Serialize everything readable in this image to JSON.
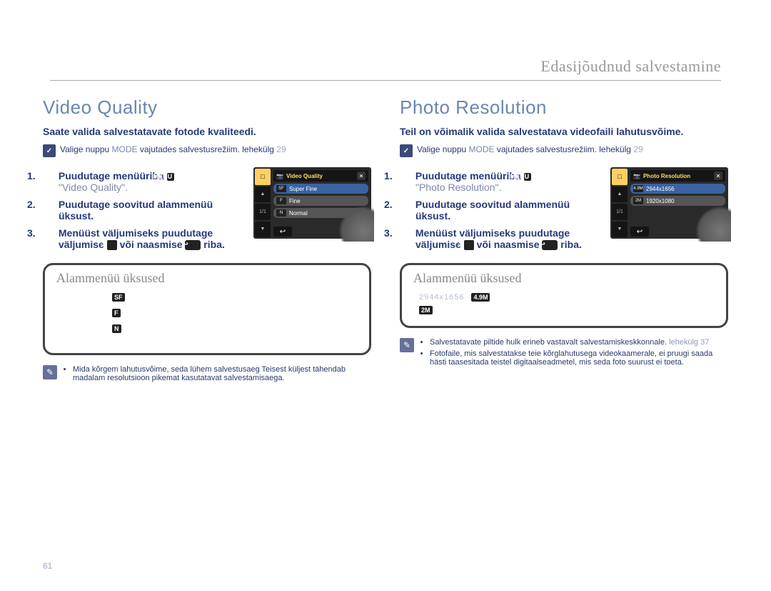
{
  "header": {
    "breadcrumb": "Edasijõudnud salvestamine",
    "page_number": "61"
  },
  "left": {
    "title": "Video Quality",
    "intro": "Saate valida salvestatavate fotode kvaliteedi.",
    "precheck": {
      "icon": "✓",
      "text_a": "Valige nuppu ",
      "mode": "MODE",
      "text_b": " vajutades salvestusrežiim. lehekülg ",
      "page": "29"
    },
    "steps": {
      "s1_a": "Puudutage menüüriba ",
      "s1_menu": "MENU",
      "s1_b": "  ",
      "s1_quote": "\"Video Quality\".",
      "s2": "Puudutage soovitud alammenüü üksust.",
      "s3_a": "Menüüst väljumiseks puudutage väljumise ",
      "s3_x": "✕",
      "s3_b": "  või naasmise ",
      "s3_back": "↩",
      "s3_c": "  riba."
    },
    "lcd": {
      "title": "Video Quality",
      "rail_active": "⬚",
      "rail_page": "1/1",
      "options": [
        {
          "icon": "SF",
          "label": "Super Fine",
          "selected": true
        },
        {
          "icon": "F",
          "label": "Fine",
          "selected": false
        },
        {
          "icon": "N",
          "label": "Normal",
          "selected": false
        }
      ],
      "close": "✕",
      "back": "↩"
    },
    "subpanel": {
      "title": "Alammenüü üksused",
      "rows": [
        {
          "chip": "SF",
          "label": ""
        },
        {
          "chip": "F",
          "label": ""
        },
        {
          "chip": "N",
          "label": ""
        }
      ]
    },
    "note": {
      "icon": "✎",
      "bullets": [
        "Mida kõrgem lahutusvõime, seda lühem salvestusaeg  Teisest küljest tähendab madalam resolutsioon pikemat kasutatavat salvestamisaega."
      ]
    }
  },
  "right": {
    "title": "Photo Resolution",
    "intro": "Teil on võimalik valida salvestatava videofaili lahutusvõime.",
    "precheck": {
      "icon": "✓",
      "text_a": "Valige nuppu ",
      "mode": "MODE",
      "text_b": " vajutades salvestusrežiim.  lehekülg ",
      "page": "29"
    },
    "steps": {
      "s1_a": "Puudutage menüüriba ",
      "s1_menu": "MENU",
      "s1_b": "  ",
      "s1_quote": "\"Photo Resolution\".",
      "s2": "Puudutage soovitud alammenüü üksust.",
      "s3_a": "Menüüst väljumiseks puudutage väljumise ",
      "s3_x": "✕",
      "s3_b": "  või naasmise ",
      "s3_back": "↩",
      "s3_c": "  riba."
    },
    "lcd": {
      "title": "Photo Resolution",
      "rail_active": "⬚",
      "rail_page": "1/1",
      "options": [
        {
          "icon": "4.9M",
          "label": "2944x1656",
          "selected": true
        },
        {
          "icon": "2M",
          "label": "1920x1080",
          "selected": false
        }
      ],
      "close": "✕",
      "back": "↩"
    },
    "subpanel": {
      "title": "Alammenüü üksused",
      "rows": [
        {
          "dotted": "2944x1656 ",
          "chip": "4.9M"
        },
        {
          "dotted": "",
          "chip": "2M"
        }
      ]
    },
    "note": {
      "icon": "✎",
      "bullets_primary": "Salvestatavate piltide hulk erineb vastavalt salvestamiskeskkonnale. ",
      "bullets_primary_pale": "lehekülg 37",
      "bullets_secondary": "Fotofaile, mis salvestatakse teie kõrglahutusega videokaamerale, ei pruugi saada hästi taasesitada teistel digitaalseadmetel, mis seda foto suurust ei toeta."
    }
  }
}
